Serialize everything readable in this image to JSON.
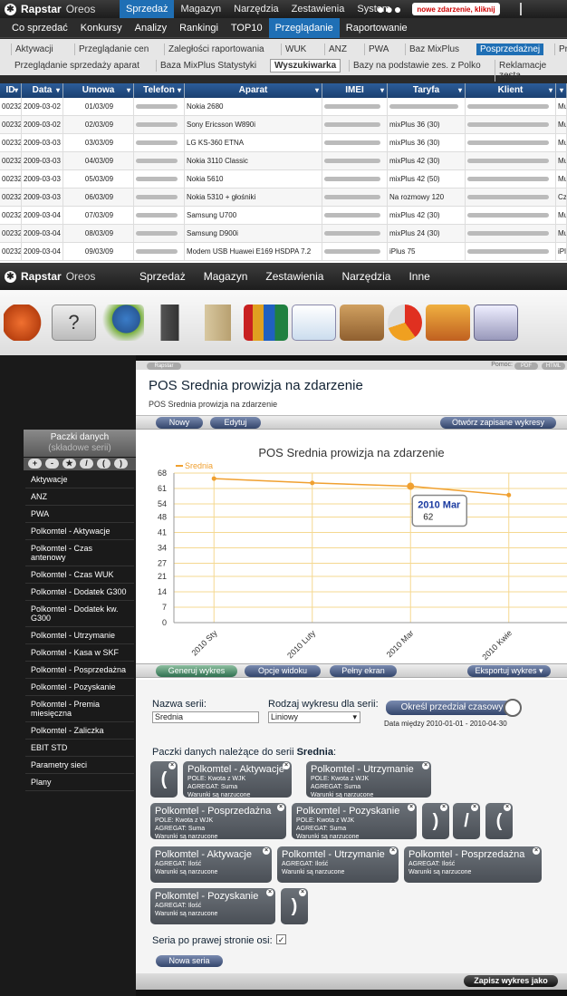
{
  "app1": {
    "logo": "Rapstar",
    "logo_suffix": "Oreos",
    "menu": [
      "Sprzedaż",
      "Magazyn",
      "Narzędzia",
      "Zestawienia",
      "System"
    ],
    "dots": "●●●",
    "notify_button": "nowe zdarzenie, kliknij",
    "submenu": [
      "Co sprzedać",
      "Konkursy",
      "Analizy",
      "Rankingi",
      "TOP10",
      "Przeglądanie",
      "Raportowanie"
    ],
    "tabs_row1": [
      "Aktywacji",
      "Przeglądanie cen",
      "Zaległości raportowania",
      "WUK",
      "ANZ",
      "PWA",
      "Baz MixPlus",
      "Posprzedażnej",
      "Pr"
    ],
    "tabs_row2": [
      "Przeglądanie sprzedaży aparat",
      "Baza MixPlus Statystyki",
      "Wyszukiwarka",
      "Bazy na podstawie zes. z Polko",
      "Reklamacje zesta"
    ]
  },
  "table": {
    "headers": [
      "ID",
      "Data",
      "Umowa",
      "Telefon",
      "Aparat",
      "IMEI",
      "Taryfa",
      "Klient",
      ""
    ],
    "rows": [
      [
        "00232",
        "2009-03-02",
        "01/03/09",
        "",
        "Nokia 2680",
        "",
        "",
        "",
        "Mu"
      ],
      [
        "00232",
        "2009-03-02",
        "02/03/09",
        "",
        "Sony Ericsson W890i",
        "",
        "mixPlus 36 (30)",
        "",
        "Mu"
      ],
      [
        "00232",
        "2009-03-03",
        "03/03/09",
        "",
        "LG KS-360 ETNA",
        "",
        "mixPlus 36 (30)",
        "",
        "Mu"
      ],
      [
        "00232",
        "2009-03-03",
        "04/03/09",
        "",
        "Nokia 3110 Classic",
        "",
        "mixPlus 42 (30)",
        "",
        "Mu"
      ],
      [
        "00232",
        "2009-03-03",
        "05/03/09",
        "",
        "Nokia 5610",
        "",
        "mixPlus 42 (50)",
        "",
        "Mu"
      ],
      [
        "00232",
        "2009-03-03",
        "06/03/09",
        "",
        "Nokia 5310 + głośniki",
        "",
        "Na rozmowy 120",
        "",
        "Cz"
      ],
      [
        "00232",
        "2009-03-04",
        "07/03/09",
        "",
        "Samsung U700",
        "",
        "mixPlus 42 (30)",
        "",
        "Mu"
      ],
      [
        "00232",
        "2009-03-04",
        "08/03/09",
        "",
        "Samsung D900i",
        "",
        "mixPlus 24 (30)",
        "",
        "Mu"
      ],
      [
        "00232",
        "2009-03-04",
        "09/03/09",
        "",
        "Modem USB Huawei E169 HSDPA 7.2",
        "",
        "iPlus 75",
        "",
        "iPl"
      ]
    ]
  },
  "app2": {
    "logo": "Rapstar",
    "logo_suffix": "Oreos",
    "menu": [
      "Sprzedaż",
      "Magazyn",
      "Zestawienia",
      "Narzędzia",
      "Inne"
    ],
    "icons": [
      "megaphone-icon",
      "help-icon",
      "user-sync-icon",
      "phone-icon",
      "clipboard-icon",
      "books-icon",
      "spreadsheet-icon",
      "warehouse-icon",
      "pie-chart-icon",
      "transfer-icon",
      "report-icon"
    ]
  },
  "left_panel": {
    "title": "Paczki danych",
    "subtitle": "(składowe serii)",
    "tools": [
      "+",
      "-",
      "★",
      "/",
      "(",
      ")"
    ],
    "items": [
      "Aktywacje",
      "ANZ",
      "PWA",
      "Polkomtel - Aktywacje",
      "Polkomtel - Czas antenowy",
      "Polkomtel - Czas WUK",
      "Polkomtel - Dodatek G300",
      "Polkomtel - Dodatek kw. G300",
      "Polkomtel - Utrzymanie",
      "Polkomtel - Kasa w SKF",
      "Polkomtel - Posprzedażna",
      "Polkomtel - Pozyskanie",
      "Polkomtel - Premia miesięczna",
      "Polkomtel - Zaliczka",
      "EBIT STD",
      "Parametry sieci",
      "Plany"
    ]
  },
  "main": {
    "crumb": "Rapstar",
    "help": "Pomoc:",
    "pdf": "PDF",
    "html": "HTML",
    "title": "POS Srednia prowizja na zdarzenie",
    "subtitle": "POS Srednia prowizja na zdarzenie",
    "btn_new": "Nowy",
    "btn_edit": "Edytuj",
    "btn_open": "Otwórz zapisane wykresy",
    "btn_generate": "Generuj wykres",
    "btn_view": "Opcje widoku",
    "btn_full": "Pełny ekran",
    "btn_export": "Eksportuj wykres ▾",
    "tooltip_title": "2010 Mar",
    "tooltip_value": "62",
    "form": {
      "series_name_label": "Nazwa serii:",
      "series_name_value": "Srednia",
      "chart_type_label": "Rodzaj wykresu dla serii:",
      "chart_type_value": "Liniowy",
      "period_button": "Określ przedział czasowy",
      "period_text": "Data między 2010-01-01 - 2010-04-30",
      "packages_label_prefix": "Paczki danych należące do serii ",
      "packages_label_series": "Srednia",
      "packages_label_suffix": ":",
      "right_axis_label": "Seria po prawej stronie osi:",
      "right_axis_mark": "✓",
      "new_series": "Nowa seria",
      "save_chart": "Zapisz wykres jako"
    },
    "chips": [
      {
        "title": "Polkomtel - Aktywacje",
        "l1": "POLE: Kwota z WJK",
        "l2": "AGREGAT: Suma",
        "l3": "Warunki są narzucone"
      },
      {
        "title": "Polkomtel - Utrzymanie",
        "l1": "POLE: Kwota z WJK",
        "l2": "AGREGAT: Suma",
        "l3": "Warunki są narzucone"
      },
      {
        "title": "Polkomtel - Posprzedażna",
        "l1": "POLE: Kwota z WJK",
        "l2": "AGREGAT: Suma",
        "l3": "Warunki są narzucone"
      },
      {
        "title": "Polkomtel - Pozyskanie",
        "l1": "POLE: Kwota z WJK",
        "l2": "AGREGAT: Suma",
        "l3": "Warunki są narzucone"
      },
      {
        "title": "Polkomtel - Aktywacje",
        "l1": "AGREGAT: Ilość",
        "l2": "Warunki są narzucone"
      },
      {
        "title": "Polkomtel - Utrzymanie",
        "l1": "AGREGAT: Ilość",
        "l2": "Warunki są narzucone"
      },
      {
        "title": "Polkomtel - Posprzedażna",
        "l1": "AGREGAT: Ilość",
        "l2": "Warunki są narzucone"
      },
      {
        "title": "Polkomtel - Pozyskanie",
        "l1": "AGREGAT: Ilość",
        "l2": "Warunki są narzucone"
      }
    ],
    "parens": [
      "(",
      ")",
      "/",
      "(",
      ")"
    ]
  },
  "chart_data": {
    "type": "line",
    "title": "POS Srednia prowizja na zdarzenie",
    "categories": [
      "2010 Sty",
      "2010 Luty",
      "2010 Mar",
      "2010 Kwie"
    ],
    "series": [
      {
        "name": "Srednia",
        "values": [
          65.5,
          63.5,
          62,
          58
        ]
      }
    ],
    "ylim": [
      0,
      68
    ],
    "yticks": [
      0,
      7,
      14,
      21,
      27,
      34,
      41,
      48,
      54,
      61,
      68
    ],
    "grid": true,
    "colors": {
      "line": "#f0a030",
      "grid": "#f5d890"
    }
  }
}
